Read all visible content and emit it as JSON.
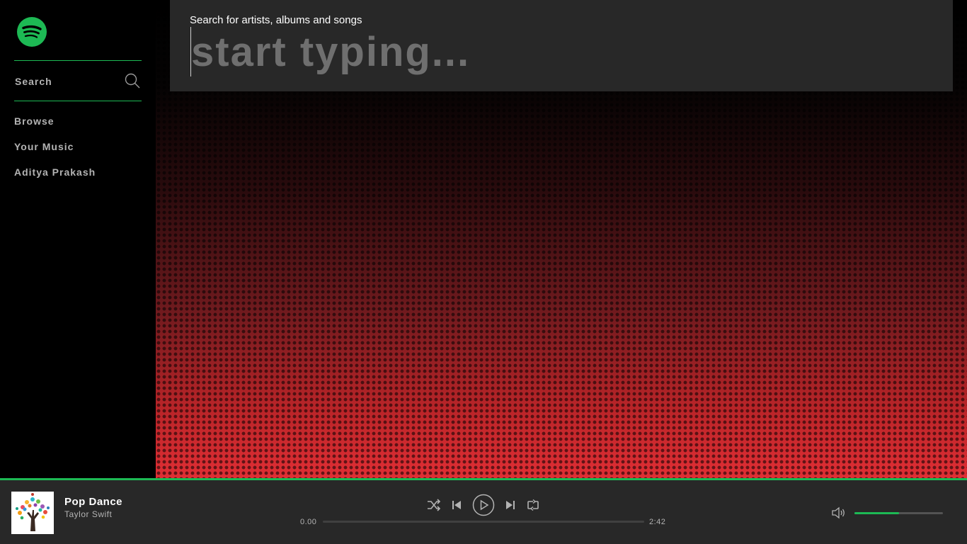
{
  "sidebar": {
    "search_label": "Search",
    "nav": [
      {
        "label": "Browse"
      },
      {
        "label": "Your Music"
      },
      {
        "label": "Aditya Prakash"
      }
    ]
  },
  "search_panel": {
    "hint": "Search for artists, albums and songs",
    "placeholder": "start typing...",
    "value": ""
  },
  "player": {
    "track_title": "Pop Dance",
    "track_artist": "Taylor Swift",
    "elapsed": "0.00",
    "duration": "2:42",
    "progress_fraction": 0.0,
    "volume_fraction": 0.5
  },
  "colors": {
    "accent": "#1db954",
    "panel": "#282828",
    "sidebar": "#000000",
    "gradient_bottom": "#e02e34"
  }
}
